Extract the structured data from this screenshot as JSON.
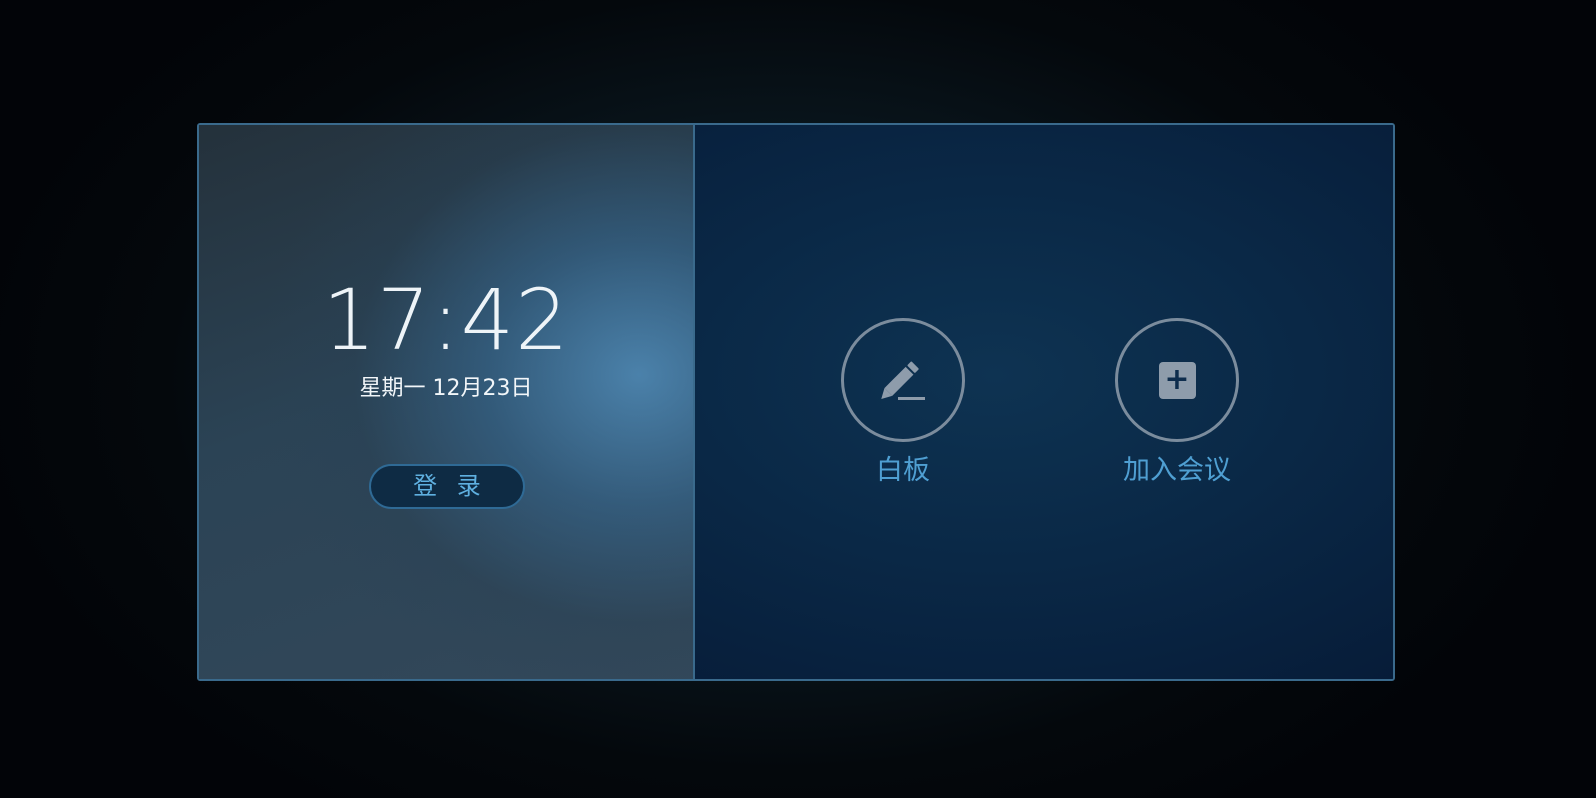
{
  "clock": {
    "time": "17:42",
    "date": "星期一 12月23日"
  },
  "login": {
    "label": "登 录"
  },
  "actions": [
    {
      "label": "白板",
      "icon": "pencil-icon"
    },
    {
      "label": "加入会议",
      "icon": "plus-box-icon"
    }
  ],
  "colors": {
    "accent": "#4f9fd2",
    "border": "#3a6a8c",
    "icon": "#8e9cab"
  }
}
